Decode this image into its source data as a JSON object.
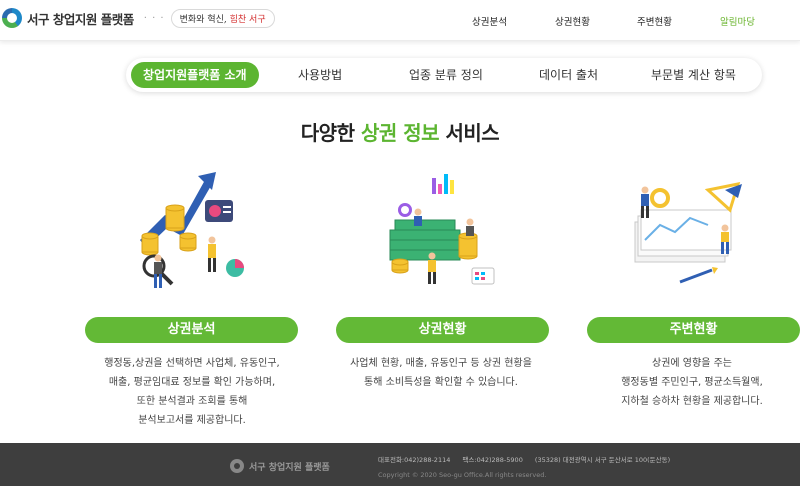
{
  "header": {
    "logo_text": "서구 창업지원 플랫폼",
    "dots": "· · ·",
    "slogan_part1": "변화와 혁신,",
    "slogan_part2": "힘찬 서구",
    "nav": [
      {
        "label": "상권분석"
      },
      {
        "label": "상권현황"
      },
      {
        "label": "주변현황"
      },
      {
        "label": "알림마당"
      }
    ],
    "active_color": "#6ab42d"
  },
  "tabs": [
    {
      "label": "창업지원플랫폼 소개"
    },
    {
      "label": "사용방법"
    },
    {
      "label": "업종 분류 정의"
    },
    {
      "label": "데이터 출처"
    },
    {
      "label": "부문별 계산 항목"
    }
  ],
  "headline": {
    "prefix": "다양한",
    "highlight": "상권 정보",
    "suffix": "서비스"
  },
  "cards": [
    {
      "title": "상권분석",
      "icon": "chart-analysis-illustration",
      "lines": [
        "행정동,상권을 선택하면 사업체, 유동인구,",
        "매출, 평균임대료 정보를 확인 가능하며,",
        "또한 분석결과 조회를 통해",
        "분석보고서를 제공합니다."
      ]
    },
    {
      "title": "상권현황",
      "icon": "money-stats-illustration",
      "lines": [
        "사업체 현황, 매출, 유동인구 등 상권 현황을",
        "통해 소비특성을 확인할 수 있습니다."
      ]
    },
    {
      "title": "주변현황",
      "icon": "documents-charts-illustration",
      "lines": [
        "상권에 영향을 주는",
        "행정동별 주민인구, 평균소득월액,",
        "지하철 승하차 현황을 제공합니다."
      ]
    }
  ],
  "footer": {
    "logo_text": "서구 창업지원 플랫폼",
    "phone": "대표전화:042)288-2114",
    "fax": "팩스:042)288-5900",
    "address": "(35328) 대전광역시 서구 둔산서로 100(둔산동)",
    "copyright": "Copyright © 2020 Seo-gu Office.All rights reserved."
  },
  "colors": {
    "brand_green": "#5cb531",
    "footer_bg": "#3e3e3e"
  }
}
